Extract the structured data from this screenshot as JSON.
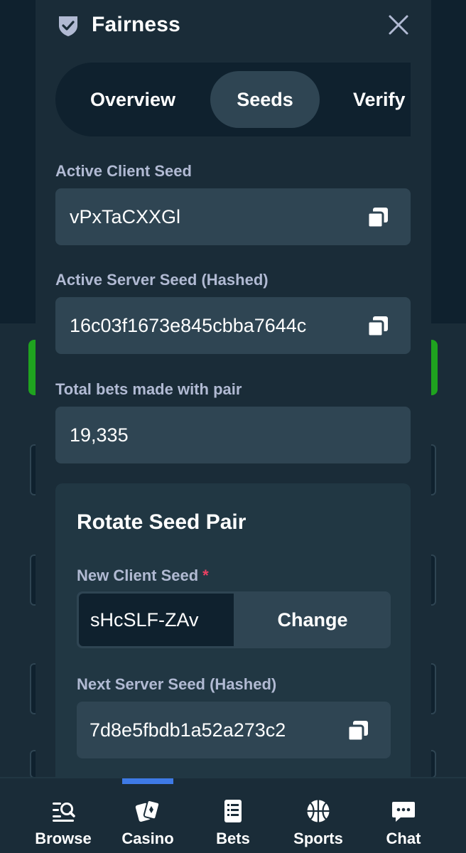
{
  "modal": {
    "title": "Fairness",
    "tabs": [
      {
        "label": "Overview",
        "active": false
      },
      {
        "label": "Seeds",
        "active": true
      },
      {
        "label": "Verify",
        "active": false
      }
    ],
    "active_client_seed": {
      "label": "Active Client Seed",
      "value": "vPxTaCXXGl"
    },
    "active_server_seed": {
      "label": "Active Server Seed (Hashed)",
      "value": "16c03f1673e845cbba7644c"
    },
    "total_bets": {
      "label": "Total bets made with pair",
      "value": "19,335"
    },
    "rotate": {
      "title": "Rotate Seed Pair",
      "new_client_seed_label": "New Client Seed",
      "required_marker": "*",
      "new_client_seed_value": "sHcSLF-ZAv",
      "change_label": "Change",
      "next_server_seed_label": "Next Server Seed (Hashed)",
      "next_server_seed_value": "7d8e5fbdb1a52a273c2"
    }
  },
  "bottom_nav": {
    "items": [
      {
        "label": "Browse",
        "icon": "browse-search-icon",
        "active": false
      },
      {
        "label": "Casino",
        "icon": "playing-cards-icon",
        "active": true
      },
      {
        "label": "Bets",
        "icon": "bet-slip-icon",
        "active": false
      },
      {
        "label": "Sports",
        "icon": "basketball-icon",
        "active": false
      },
      {
        "label": "Chat",
        "icon": "chat-bubble-icon",
        "active": false
      }
    ]
  },
  "colors": {
    "background": "#1a2c38",
    "surface_dark": "#0f212e",
    "field": "#2f4553",
    "card": "#213743",
    "label": "#b1bad3",
    "accent_blue": "#3e7ae6",
    "required_red": "#ed4163",
    "bet_green": "#1fa31f"
  }
}
